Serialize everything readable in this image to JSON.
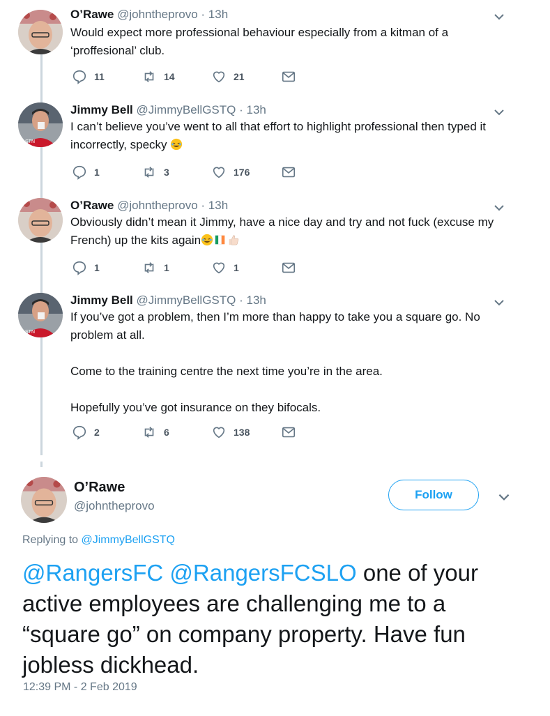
{
  "thread": [
    {
      "name": "O’Rawe",
      "handle": "@johntheprovo",
      "time": "13h",
      "text": [
        "Would expect more professional behaviour especially from a kitman of a ‘proffesional’ club."
      ],
      "replies": "11",
      "retweets": "14",
      "likes": "21",
      "avatar": "bald-man-avatar"
    },
    {
      "name": "Jimmy Bell",
      "handle": "@JimmyBellGSTQ",
      "time": "13h",
      "text": [
        "I can’t believe you’ve went to all that effort to highlight professional then typed it incorrectly, specky"
      ],
      "emoji": "rolling-laughing-emoji",
      "replies": "1",
      "retweets": "3",
      "likes": "176",
      "avatar": "red-shirt-avatar"
    },
    {
      "name": "O’Rawe",
      "handle": "@johntheprovo",
      "time": "13h",
      "text": [
        "Obviously didn’t mean it Jimmy, have a nice day and try and not fuck (excuse my French) up the kits again"
      ],
      "emoji": "laughing-irish-flag-thumbs-up-emoji",
      "replies": "1",
      "retweets": "1",
      "likes": "1",
      "avatar": "bald-man-avatar"
    },
    {
      "name": "Jimmy Bell",
      "handle": "@JimmyBellGSTQ",
      "time": "13h",
      "text": [
        "If you’ve got a problem, then I’m more than happy to take you a square go.  No problem at all.",
        "Come to the training centre the next time you’re in the area.",
        "Hopefully you’ve got insurance on they bifocals."
      ],
      "replies": "2",
      "retweets": "6",
      "likes": "138",
      "avatar": "red-shirt-avatar"
    }
  ],
  "main": {
    "name": "O’Rawe",
    "handle": "@johntheprovo",
    "follow_label": "Follow",
    "replying_prefix": "Replying to ",
    "replying_to": "@JimmyBellGSTQ",
    "mention1": "@RangersFC",
    "mention2": "@RangersFCSLO",
    "text": " one of your active employees are challenging me to a “square go” on company property. Have fun jobless dickhead.",
    "timestamp": "12:39 PM - 2 Feb 2019"
  },
  "colors": {
    "accent": "#1da1f2",
    "muted": "#657786",
    "line": "#ccd6dd"
  }
}
